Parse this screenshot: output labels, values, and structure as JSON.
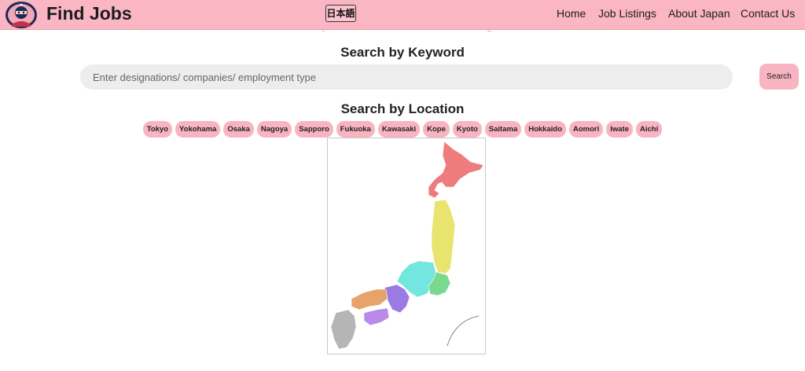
{
  "brand": {
    "name": "Find Jobs",
    "logo_icon": "ninja-logo-icon"
  },
  "header": {
    "language_toggle": "日本語",
    "nav": [
      {
        "label": "Home"
      },
      {
        "label": "Job Listings"
      },
      {
        "label": "About Japan"
      },
      {
        "label": "Contact Us"
      }
    ]
  },
  "keyword_search": {
    "title": "Search by Keyword",
    "placeholder": "Enter designations/ companies/ employment type",
    "button_label": "Search"
  },
  "location_search": {
    "title": "Search by Location",
    "locations": [
      "Tokyo",
      "Yokohama",
      "Osaka",
      "Nagoya",
      "Sapporo",
      "Fukuoka",
      "Kawasaki",
      "Kope",
      "Kyoto",
      "Saitama",
      "Hokkaido",
      "Aomori",
      "Iwate",
      "Aichi"
    ]
  },
  "map": {
    "region_colors": {
      "hokkaido": "#ef7c7c",
      "tohoku": "#e8e46e",
      "kanto": "#7bd88f",
      "chubu": "#74e6e0",
      "kinki": "#9b7be3",
      "chugoku": "#e6a36a",
      "shikoku": "#b98ae8",
      "kyushu": "#b5b5b5"
    }
  },
  "colors": {
    "nav_bg": "#fbb6c3",
    "chip_bg": "#f9b4c2",
    "input_bg": "#ededed"
  }
}
